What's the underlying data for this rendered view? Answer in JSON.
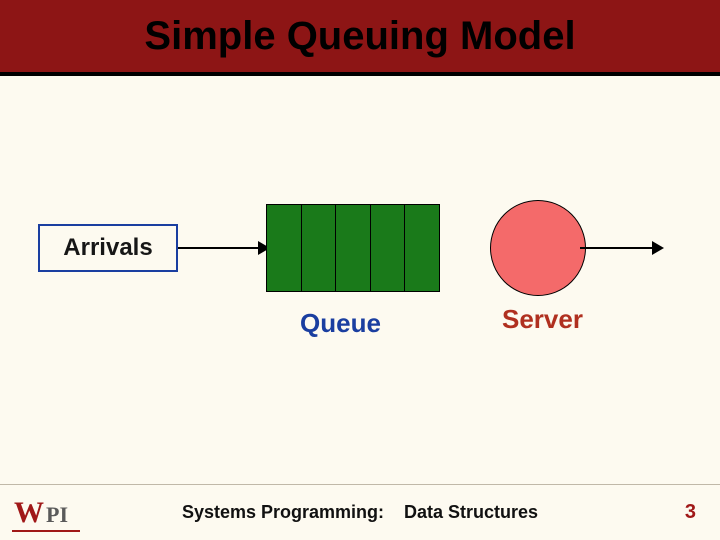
{
  "title": "Simple Queuing Model",
  "diagram": {
    "arrivals_label": "Arrivals",
    "queue_label": "Queue",
    "server_label": "Server",
    "queue_slots": 5
  },
  "footer": {
    "course_label": "Systems Programming:",
    "topic_label": "Data Structures",
    "logo": {
      "w": "W",
      "pi": "PI"
    }
  },
  "page_number": "3",
  "colors": {
    "title_bg": "#8d1515",
    "queue_fill": "#1a7a1a",
    "server_fill": "#f46a6a",
    "accent_red": "#a01818",
    "accent_blue": "#1a3ea0",
    "page_bg": "#fdfaf0"
  }
}
